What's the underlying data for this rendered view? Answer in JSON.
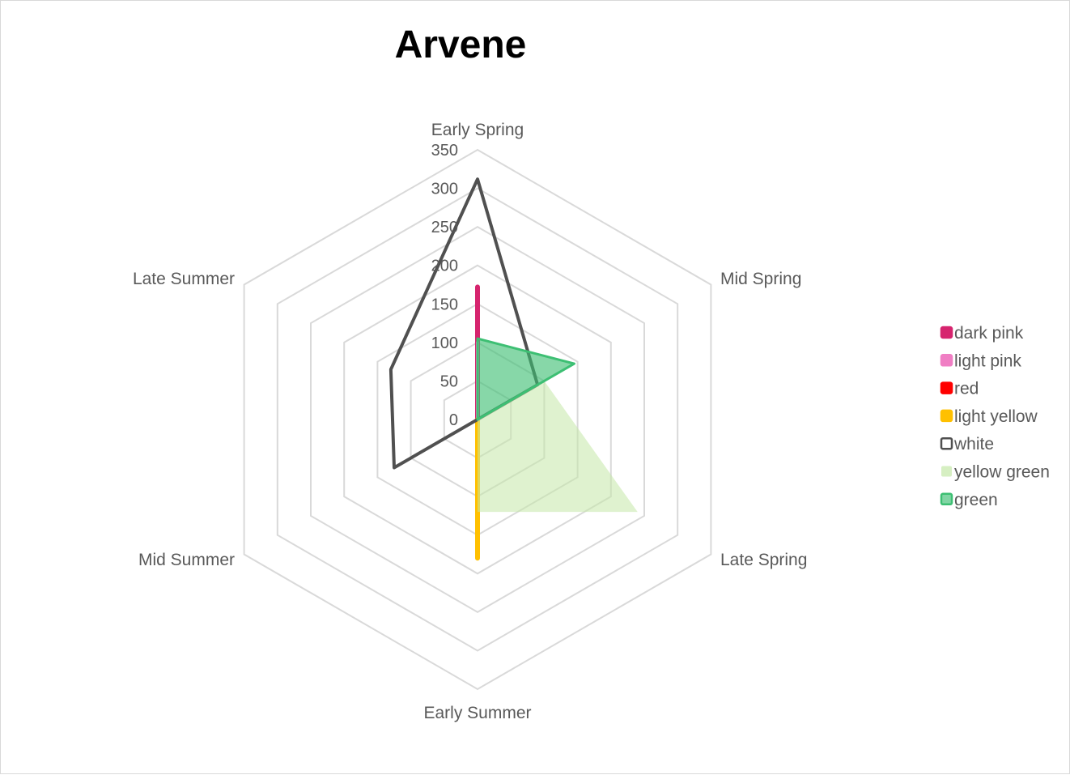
{
  "chart_data": {
    "type": "radar",
    "title": "Arvene",
    "categories": [
      "Early Spring",
      "Mid Spring",
      "Late Spring",
      "Early Summer",
      "Mid Summer",
      "Late Summer"
    ],
    "ticks": [
      0,
      50,
      100,
      150,
      200,
      250,
      300,
      350
    ],
    "rlim": [
      0,
      350
    ],
    "grid": true,
    "legend_position": "right",
    "series": [
      {
        "name": "dark pink",
        "values": [
          172,
          0,
          0,
          0,
          0,
          0
        ],
        "color": "#d6246e",
        "fill": false
      },
      {
        "name": "light pink",
        "values": [
          100,
          0,
          0,
          0,
          0,
          0
        ],
        "color": "#f07ec4",
        "fill": false
      },
      {
        "name": "red",
        "values": [
          0,
          0,
          0,
          0,
          0,
          0
        ],
        "color": "#ff0000",
        "fill": false
      },
      {
        "name": "light yellow",
        "values": [
          0,
          0,
          0,
          180,
          0,
          0
        ],
        "color": "#ffc000",
        "fill": false
      },
      {
        "name": "white",
        "values": [
          312,
          90,
          0,
          0,
          125,
          130
        ],
        "color": "#505050",
        "fill": false
      },
      {
        "name": "yellow green",
        "values": [
          0,
          100,
          240,
          120,
          0,
          0
        ],
        "color": "#c5e8a8",
        "fill": true
      },
      {
        "name": "green",
        "values": [
          105,
          145,
          0,
          0,
          0,
          0
        ],
        "color": "#3dbf73",
        "fill": true
      }
    ]
  }
}
